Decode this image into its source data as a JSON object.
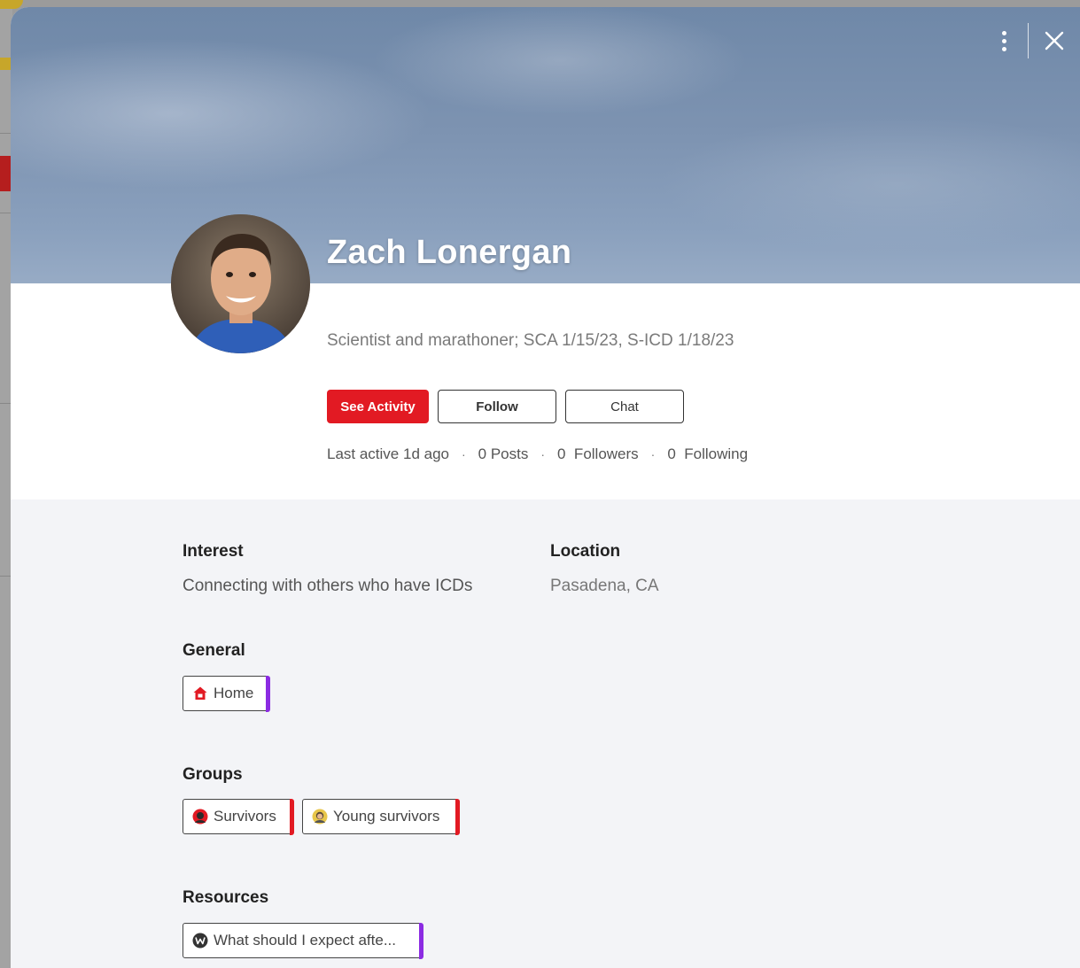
{
  "profile": {
    "name": "Zach Lonergan",
    "bio": "Scientist and marathoner; SCA 1/15/23, S-ICD 1/18/23"
  },
  "actions": {
    "see_activity": "See Activity",
    "follow": "Follow",
    "chat": "Chat"
  },
  "stats": {
    "last_active": "Last active 1d ago",
    "posts": "0 Posts",
    "followers": "0  Followers",
    "following": "0  Following",
    "separator": "·"
  },
  "details": {
    "interest_label": "Interest",
    "interest_value": "Connecting with others who have ICDs",
    "location_label": "Location",
    "location_value": "Pasadena, CA"
  },
  "general": {
    "label": "General",
    "items": [
      {
        "label": "Home",
        "icon": "home-icon",
        "accent": "#8b2be2"
      }
    ]
  },
  "groups": {
    "label": "Groups",
    "items": [
      {
        "label": "Survivors",
        "icon": "survivors-group-icon",
        "accent": "#e21a23"
      },
      {
        "label": "Young survivors",
        "icon": "young-survivors-group-icon",
        "accent": "#e21a23"
      }
    ]
  },
  "resources": {
    "label": "Resources",
    "items": [
      {
        "label": "What should I expect afte...",
        "icon": "w-icon",
        "accent": "#8b2be2"
      }
    ]
  },
  "colors": {
    "brand_red": "#e21a23",
    "purple_accent": "#8b2be2"
  }
}
